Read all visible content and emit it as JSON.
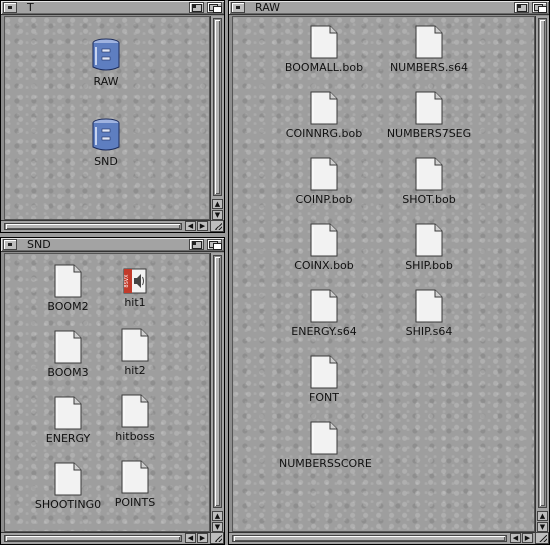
{
  "windows": {
    "t": {
      "title": "T",
      "icons": [
        {
          "label": "RAW",
          "icon": "drawer-icon"
        },
        {
          "label": "SND",
          "icon": "drawer-icon"
        }
      ]
    },
    "snd": {
      "title": "SND",
      "icons": [
        {
          "label": "BOOM2",
          "icon": "document-icon"
        },
        {
          "label": "hit1",
          "icon": "sound-file-icon"
        },
        {
          "label": "BOOM3",
          "icon": "document-icon"
        },
        {
          "label": "hit2",
          "icon": "document-icon"
        },
        {
          "label": "ENERGY",
          "icon": "document-icon"
        },
        {
          "label": "hitboss",
          "icon": "document-icon"
        },
        {
          "label": "SHOOTING0",
          "icon": "document-icon"
        },
        {
          "label": "POINTS",
          "icon": "document-icon"
        }
      ]
    },
    "raw": {
      "title": "RAW",
      "icons": [
        {
          "label": "BOOMALL.bob",
          "icon": "document-icon"
        },
        {
          "label": "NUMBERS.s64",
          "icon": "document-icon"
        },
        {
          "label": "COINNRG.bob",
          "icon": "document-icon"
        },
        {
          "label": "NUMBERS7SEG",
          "icon": "document-icon"
        },
        {
          "label": "COINP.bob",
          "icon": "document-icon"
        },
        {
          "label": "SHOT.bob",
          "icon": "document-icon"
        },
        {
          "label": "COINX.bob",
          "icon": "document-icon"
        },
        {
          "label": "SHIP.bob",
          "icon": "document-icon"
        },
        {
          "label": "ENERGY.s64",
          "icon": "document-icon"
        },
        {
          "label": "SHIP.s64",
          "icon": "document-icon"
        },
        {
          "label": "FONT",
          "icon": "document-icon"
        },
        {
          "label": "NUMBERSSCORE",
          "icon": "document-icon"
        }
      ]
    }
  },
  "sound_badge_text": "8SVX",
  "colors": {
    "window_frame": "#8d8d8d",
    "backdrop": "#9e9e9e",
    "drawer_blue": "#5e7ec0",
    "doc_white": "#f2f2f2"
  }
}
